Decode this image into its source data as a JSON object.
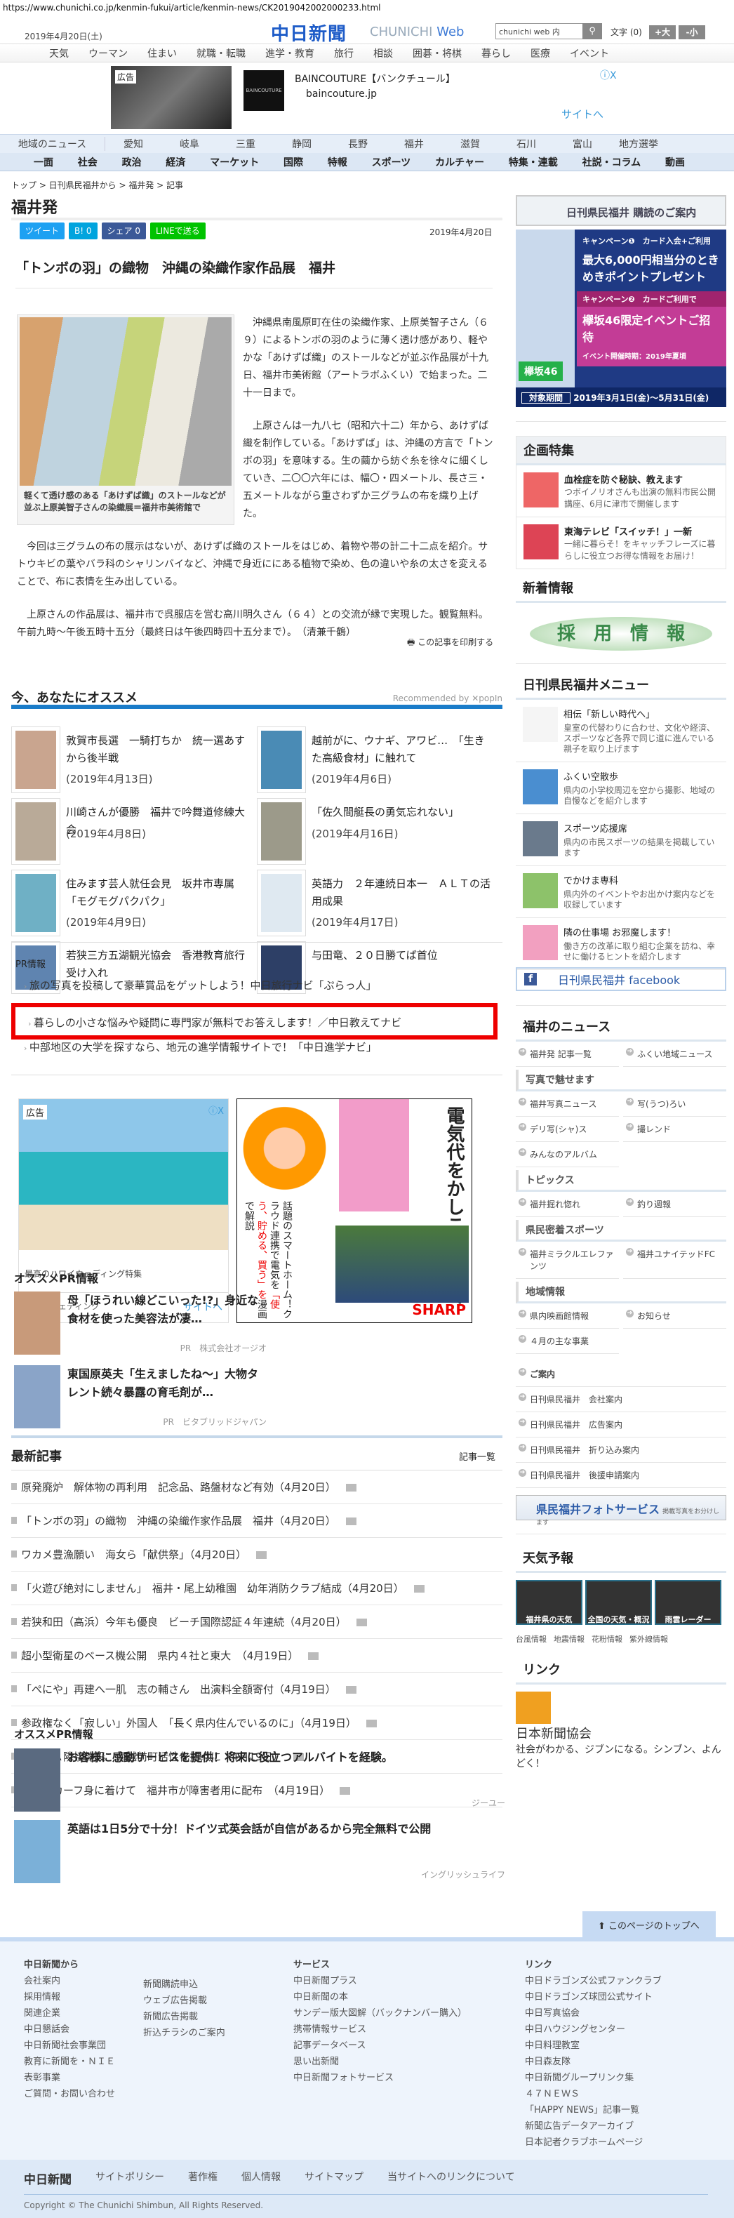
{
  "url": "https://www.chunichi.co.jp/kenmin-fukui/article/kenmin-news/CK2019042002000233.html",
  "header": {
    "date": "2019年4月20日(土)",
    "logo": "中日新聞",
    "logo_sub1": "CHUNICHI",
    "logo_sub2": "Web",
    "search_value": "chunichi web 内",
    "font_label": "文字 (0)",
    "font_up": "+大",
    "font_down": "-小"
  },
  "topnav": [
    "天気",
    "ウーマン",
    "住まい",
    "就職・転職",
    "進学・教育",
    "旅行",
    "相談",
    "囲碁・将棋",
    "暮らし",
    "医療",
    "イベント"
  ],
  "ad_top": {
    "tag": "広告",
    "title": "BAINCOUTURE【バンクチュール】",
    "domain": "baincouture.jp",
    "site": "サイトへ",
    "close": "ⓘX",
    "logo": "BAINCOUTURE"
  },
  "region_nav": [
    "地域のニュース",
    "愛知",
    "岐阜",
    "三重",
    "静岡",
    "長野",
    "福井",
    "滋賀",
    "石川",
    "富山",
    "地方選挙"
  ],
  "cat_nav": [
    "一面",
    "社会",
    "政治",
    "経済",
    "マーケット",
    "国際",
    "特報",
    "スポーツ",
    "カルチャー",
    "特集・連載",
    "社説・コラム",
    "動画"
  ],
  "breadcrumb": "トップ > 日刊県民福井から > 福井発 > 記事",
  "page_title": "福井発",
  "share": {
    "tweet": "ツイート",
    "hatena": "B! 0",
    "fb": "シェア 0",
    "line": "LINEで送る",
    "date": "2019年4月20日"
  },
  "article": {
    "title": "「トンボの羽」の織物　沖縄の染織作家作品展　福井",
    "caption": "軽くて透け感のある「あけずば織」のストールなどが並ぶ上原美智子さんの染織展＝福井市美術館で",
    "paragraphs": [
      "沖縄県南風原町在住の染織作家、上原美智子さん（６９）によるトンボの羽のように薄く透け感があり、軽やかな「あけずば織」のストールなどが並ぶ作品展が十九日、福井市美術館（アートラボふくい）で始まった。二十一日まで。",
      "上原さんは一九八七（昭和六十二）年から、あけずば織を制作している。「あけずば」は、沖縄の方言で「トンボの羽」を意味する。生の繭から紡ぐ糸を徐々に細くしていき、二〇〇六年には、幅〇・四メートル、長さ三・五メートルながら重さわずか三グラムの布を織り上げた。",
      "今回は三グラムの布の展示はないが、あけずば織のストールをはじめ、着物や帯の計二十二点を紹介。サトウキビの葉やバラ科のシャリンバイなど、沖縄で身近ににある植物で染め、色の違いや糸の太さを変えることで、布に表情を生み出している。",
      "上原さんの作品展は、福井市で呉服店を営む高川明久さん（６４）との交流が縁で実現した。観覧無料。午前九時～午後五時十五分（最終日は午後四時四十五分まで）。　（清兼千鶴）"
    ],
    "print": "この記事を印刷する"
  },
  "recommend": {
    "title": "今、あなたにオススメ",
    "by": "Recommended by ✕popIn",
    "items": [
      {
        "title": "敦賀市長選　一騎打ちか　統一選あすから後半戦",
        "date": "(2019年4月13日)"
      },
      {
        "title": "越前がに、ウナギ、アワビ…　「生きた高級食材」に触れて",
        "date": "(2019年4月6日)"
      },
      {
        "title": "川崎さんが優勝　福井で吟舞道修練大会",
        "date": "(2019年4月8日)"
      },
      {
        "title": "「佐久間艇長の勇気忘れない」",
        "date": "(2019年4月16日)"
      },
      {
        "title": "住みます芸人就任会見　坂井市専属「モグモグパクパク」",
        "date": "(2019年4月9日)"
      },
      {
        "title": "英語力　２年連続日本一　ＡＬＴの活用成果",
        "date": "(2019年4月17日)"
      },
      {
        "title": "若狭三方五湖観光協会　香港教育旅行受け入れ",
        "date": ""
      },
      {
        "title": "与田竜、２０日勝てば首位",
        "date": ""
      }
    ]
  },
  "pr_info": {
    "title": "PR情報",
    "items": [
      "旅の写真を投稿して豪華賞品をゲットしよう！中日旅行ナビ「ぷらっ人」",
      "暮らしの小さな悩みや疑問に専門家が無料でお答えします！／中日教えてナビ",
      "中部地区の大学を探すなら、地元の進学情報サイトで！「中日進学ナビ」"
    ]
  },
  "ad_mid": {
    "tag": "広告",
    "title": "最高のハワイウェディング特集",
    "sponsor": "ワタベウェディング",
    "site": "サイトへ",
    "close": "ⓘX"
  },
  "ad_sharp": {
    "headline": "電気代をかしこく節約！",
    "sub1": "話題のスマートホーム！",
    "sub2": "クラウド連携で電気を",
    "sub3": "「使う、貯める、買う」を",
    "sub4": "漫画で解説",
    "brand": "SHARP"
  },
  "osusume_pr": {
    "title": "オススメPR情報",
    "items": [
      {
        "title": "母「ほうれい線どこいった!?」身近な食材を使った美容法が凄…",
        "sponsor": "PR　株式会社オージオ"
      },
      {
        "title": "東国原英夫「生えましたね～」大物タレント続々暴露の育毛剤が…",
        "sponsor": "PR　ビタブリッドジャパン"
      }
    ]
  },
  "latest": {
    "title": "最新記事",
    "more": "記事一覧",
    "items": [
      "原発廃炉　解体物の再利用　記念品、路盤材など有効（4月20日）",
      "「トンボの羽」の織物　沖縄の染織作家作品展　福井（4月20日）",
      "ワカメ豊漁願い　海女ら「献供祭」（4月20日）",
      "「火遊び絶対にしません」　福井・尾上幼稚園　幼年消防クラブ結成（4月20日）",
      "若狭和田（高浜）今年も優良　ビーチ国際認証４年連続（4月20日）",
      "超小型衛星のベース機公開　県内４社と東大　（4月19日）",
      "「ぺにや」再建へ一肌　志の輔さん　出演料全額寄付（4月19日）",
      "参政権なく「寂しい」外国人　「長く県内住んでいるのに」（4月19日）",
      "南条ＳＡ隣接施設　南越前町活性化拠点に（4月19日）",
      "防災スカーフ身に着けて　福井市が障害者用に配布　（4月19日）"
    ]
  },
  "osusume_pr2": {
    "title": "オススメPR情報",
    "items": [
      {
        "title": "お客様に感動サービスを提供！将来に役立つアルバイトを経験。",
        "sponsor": "ジーユー"
      },
      {
        "title": "英語は1日5分で十分！ドイツ式英会話が自信があるから完全無料で公開",
        "sponsor": "イングリッシュライフ"
      }
    ]
  },
  "sidebar": {
    "subscribe": "日刊県民福井 購読のご案内",
    "big_ad": {
      "c1": "キャンペーン❶　カード入会+ご利用",
      "amount": "最大6,000円相当分のときめきポイントプレゼント",
      "c2": "キャンペーン❷　カードご利用で",
      "event": "欅坂46限定イベントご招待",
      "when": "イベント開催時期：2019年夏頃",
      "period_label": "対象期間",
      "period": "2019年3月1日(金)～5月31日(金)",
      "brand": "欅坂46"
    },
    "kikaku": {
      "title": "企画特集",
      "items": [
        {
          "title": "血栓症を防ぐ秘訣、教えます",
          "desc": "つボイノリオさんも出演の無料市民公開講座、6月に津市で開催します"
        },
        {
          "title": "東海テレビ「スイッチ！」一新",
          "desc": "一緒に暮らそ！をキャッチフレーズに暮らしに役立つお得な情報をお届け！"
        }
      ]
    },
    "shinchaku": {
      "title": "新着情報",
      "banner": "採　用　情　報"
    },
    "menu": {
      "title": "日刊県民福井メニュー",
      "items": [
        {
          "title": "相伝「新しい時代へ」",
          "desc": "皇室の代替わりに合わせ、文化や経済、スポーツなど各界で同じ道に進んでいる親子を取り上げます"
        },
        {
          "title": "ふくい空散歩",
          "desc": "県内の小学校周辺を空から撮影、地域の自慢などを紹介します"
        },
        {
          "title": "スポーツ応援席",
          "desc": "県内の市民スポーツの結果を掲載しています"
        },
        {
          "title": "でかけま専科",
          "desc": "県内外のイベントやお出かけ案内などを収録しています"
        },
        {
          "title": "隣の仕事場 お邪魔します！",
          "desc": "働き方の改革に取り組む企業を訪ね、幸せに働けるヒントを紹介します"
        }
      ]
    },
    "facebook": "日刊県民福井 facebook",
    "fukui_news": {
      "title": "福井のニュース",
      "top": [
        "福井発 記事一覧",
        "ふくい地域ニュース"
      ],
      "groups": [
        {
          "title": "写真で魅せます",
          "links": [
            "福井写真ニュース",
            "写(うつ)ろい",
            "デリ写(シャ)ス",
            "撮レンド",
            "みんなのアルバム"
          ]
        },
        {
          "title": "トピックス",
          "links": [
            "福井掘れ惚れ",
            "釣り週報"
          ]
        },
        {
          "title": "県民密着スポーツ",
          "links": [
            "福井ミラクルエレファンツ",
            "福井ユナイテッドFC"
          ]
        },
        {
          "title": "地域情報",
          "links": [
            "県内映画館情報",
            "お知らせ",
            "４月の主な事業"
          ]
        }
      ]
    },
    "annai": {
      "title": "ご案内",
      "items": [
        "日刊県民福井　会社案内",
        "日刊県民福井　広告案内",
        "日刊県民福井　折り込み案内",
        "日刊県民福井　後援申請案内"
      ]
    },
    "photo_service": {
      "title": "県民福井フォトサービス",
      "sub": "掲載写真をお分けします"
    },
    "weather": {
      "title": "天気予報",
      "tiles": [
        "福井県の天気",
        "全国の天気・概況",
        "雨雲レーダー"
      ],
      "links": [
        "台風情報",
        "地震情報",
        "花粉情報",
        "紫外線情報"
      ]
    },
    "link": {
      "title": "リンク",
      "name": "日本新聞協会",
      "desc": "社会がわかる、ジブンになる。シンブン、よんどく！"
    }
  },
  "footer": {
    "totop": "このページのトップへ",
    "col1_title": "中日新聞から",
    "col1a": [
      "会社案内",
      "採用情報",
      "関連企業",
      "中日懇話会",
      "中日新聞社会事業団",
      "教育に新聞を・ＮＩＥ",
      "表彰事業",
      "ご質問・お問い合わせ"
    ],
    "col1b": [
      "新聞購読申込",
      "ウェブ広告掲載",
      "新聞広告掲載",
      "折込チラシのご案内"
    ],
    "col2_title": "サービス",
    "col2": [
      "中日新聞プラス",
      "中日新聞の本",
      "サンデー版大図解（バックナンバー購入）",
      "携帯情報サービス",
      "記事データベース",
      "思い出新聞",
      "中日新聞フォトサービス"
    ],
    "col3_title": "リンク",
    "col3": [
      "中日ドラゴンズ公式ファンクラブ",
      "中日ドラゴンズ球団公式サイト",
      "中日写真協会",
      "中日ハウジングセンター",
      "中日料理教室",
      "中日森友隊",
      "中日新聞グループリンク集",
      "４７ＮＥＷＳ",
      "「HAPPY NEWS」記事一覧",
      "新聞広告データアーカイブ",
      "日本記者クラブホームページ"
    ],
    "bottom_logo": "中日新聞",
    "bottom": [
      "サイトポリシー",
      "著作権",
      "個人情報",
      "サイトマップ",
      "当サイトへのリンクについて"
    ],
    "copyright": "Copyright © The Chunichi Shimbun, All Rights Reserved."
  }
}
